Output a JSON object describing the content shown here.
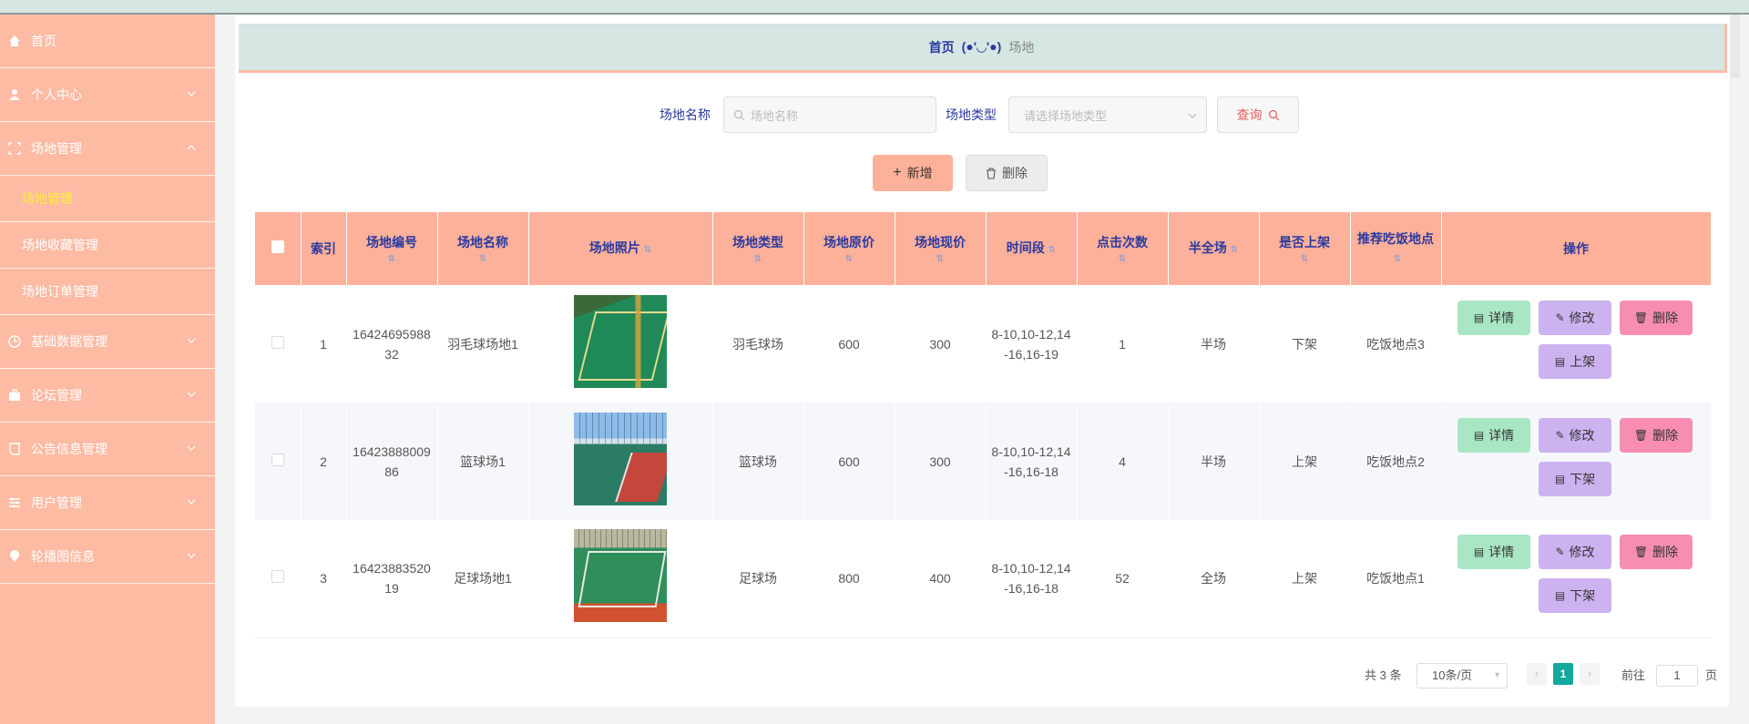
{
  "breadcrumb": {
    "home": "首页",
    "separator": "(●'◡'●)",
    "current": "场地"
  },
  "sidebar": {
    "items": [
      {
        "label": "首页",
        "icon": "home-icon"
      },
      {
        "label": "个人中心",
        "icon": "user-icon"
      },
      {
        "label": "场地管理",
        "icon": "frame-icon",
        "expanded": true,
        "children": [
          {
            "label": "场地管理",
            "active": true
          },
          {
            "label": "场地收藏管理"
          },
          {
            "label": "场地订单管理"
          }
        ]
      },
      {
        "label": "基础数据管理",
        "icon": "clock-icon"
      },
      {
        "label": "论坛管理",
        "icon": "briefcase-icon"
      },
      {
        "label": "公告信息管理",
        "icon": "document-icon"
      },
      {
        "label": "用户管理",
        "icon": "sliders-icon"
      },
      {
        "label": "轮播图信息",
        "icon": "location-icon"
      }
    ]
  },
  "search": {
    "name_label": "场地名称",
    "name_placeholder": "场地名称",
    "type_label": "场地类型",
    "type_placeholder": "请选择场地类型",
    "query_button": "查询"
  },
  "actions": {
    "add": "新增",
    "delete": "删除"
  },
  "table": {
    "headers": {
      "index": "索引",
      "code": "场地编号",
      "name": "场地名称",
      "photo": "场地照片",
      "type": "场地类型",
      "orig_price": "场地原价",
      "cur_price": "场地现价",
      "time": "时间段",
      "clicks": "点击次数",
      "half": "半全场",
      "shelf": "是否上架",
      "dining": "推荐吃饭地点",
      "ops": "操作"
    },
    "rows": [
      {
        "index": "1",
        "code": "1642469598832",
        "name": "羽毛球场地1",
        "photo": "badminton-court-photo",
        "type": "羽毛球场",
        "orig_price": "600",
        "cur_price": "300",
        "time": "8-10,10-12,14-16,16-19",
        "clicks": "1",
        "half": "半场",
        "shelf": "下架",
        "dining": "吃饭地点3",
        "shelf_action": "上架"
      },
      {
        "index": "2",
        "code": "1642388800986",
        "name": "篮球场1",
        "photo": "basketball-court-photo",
        "type": "篮球场",
        "orig_price": "600",
        "cur_price": "300",
        "time": "8-10,10-12,14-16,16-18",
        "clicks": "4",
        "half": "半场",
        "shelf": "上架",
        "dining": "吃饭地点2",
        "shelf_action": "下架"
      },
      {
        "index": "3",
        "code": "1642388352019",
        "name": "足球场地1",
        "photo": "soccer-field-photo",
        "type": "足球场",
        "orig_price": "800",
        "cur_price": "400",
        "time": "8-10,10-12,14-16,16-18",
        "clicks": "52",
        "half": "全场",
        "shelf": "上架",
        "dining": "吃饭地点1",
        "shelf_action": "下架"
      }
    ],
    "op_labels": {
      "detail": "详情",
      "edit": "修改",
      "delete": "删除"
    }
  },
  "pagination": {
    "total_text": "共 3 条",
    "page_size": "10条/页",
    "current_page": "1",
    "goto_label": "前往",
    "goto_value": "1",
    "goto_unit": "页"
  },
  "colors": {
    "sidebar_bg": "#fdbba4",
    "header_bg": "#fdb09a",
    "breadcrumb_bg": "#d5e6e3",
    "active_menu": "#ffee3a",
    "detail_btn": "#a9e6c4",
    "edit_btn": "#cdb2f0",
    "delete_btn": "#f78eb2",
    "page_active": "#13a89e"
  }
}
